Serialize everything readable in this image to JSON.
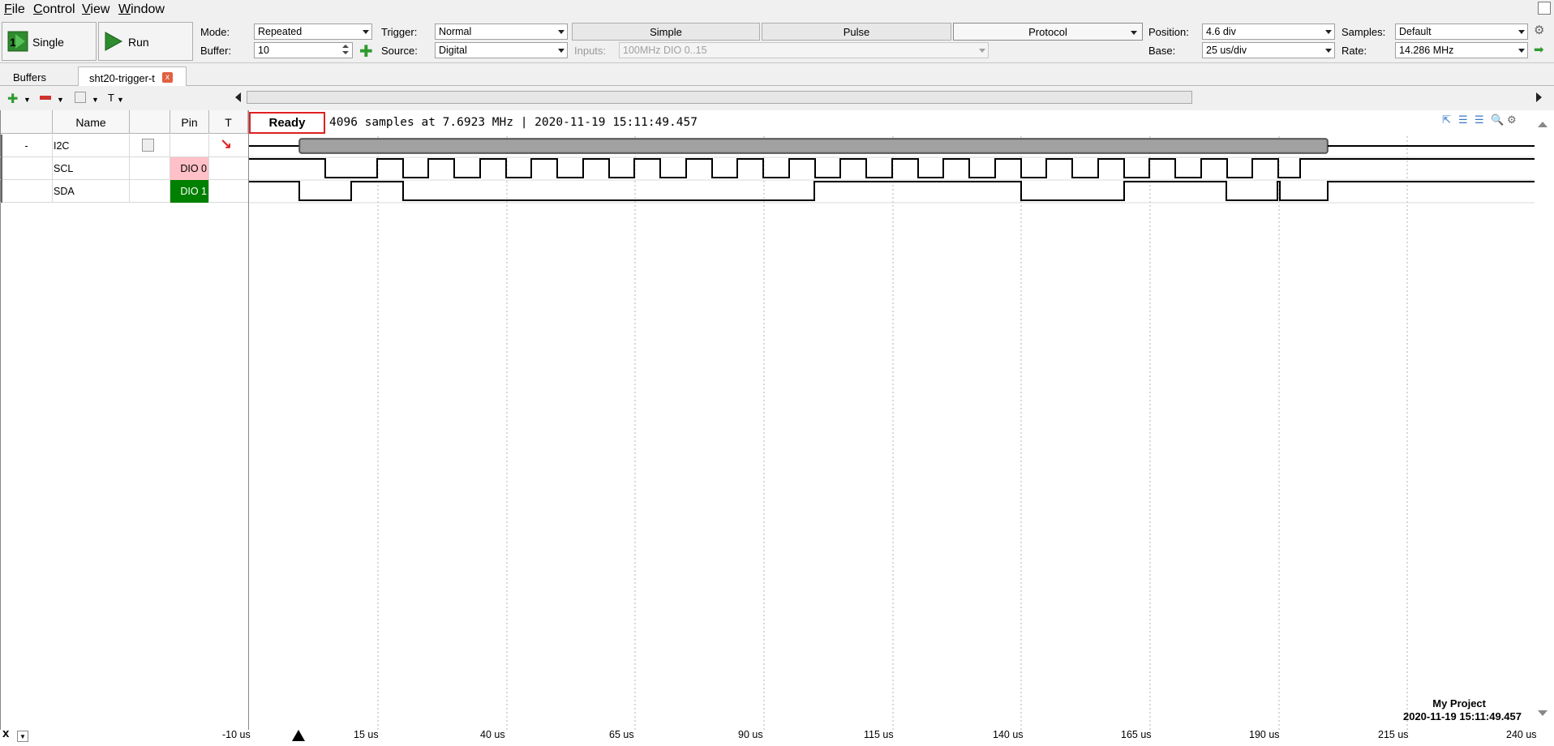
{
  "menu": {
    "items": [
      {
        "label": "File",
        "u": "F",
        "rest": "ile"
      },
      {
        "label": "Control",
        "u": "C",
        "rest": "ontrol"
      },
      {
        "label": "View",
        "u": "V",
        "rest": "iew"
      },
      {
        "label": "Window",
        "u": "W",
        "rest": "indow"
      }
    ]
  },
  "toolbar": {
    "single_label": "Single",
    "single_badge": "1",
    "run_label": "Run",
    "mode_label": "Mode:",
    "mode_value": "Repeated",
    "buffer_label": "Buffer:",
    "buffer_value": "10",
    "trigger_label": "Trigger:",
    "trigger_value": "Normal",
    "source_label": "Source:",
    "source_value": "Digital",
    "tabs": [
      "Simple",
      "Pulse",
      "Protocol"
    ],
    "inputs_label": "Inputs:",
    "inputs_value": "100MHz DIO 0..15",
    "position_label": "Position:",
    "position_value": "4.6 div",
    "base_label": "Base:",
    "base_value": "25 us/div",
    "samples_label": "Samples:",
    "samples_value": "Default",
    "rate_label": "Rate:",
    "rate_value": "14.286 MHz"
  },
  "doctabs": {
    "buffers": "Buffers",
    "file": "sht20-trigger-t",
    "close": "x"
  },
  "grid": {
    "headers": {
      "name": "Name",
      "pin": "Pin",
      "t": "T"
    },
    "rows": [
      {
        "expand": "-",
        "name": "I2C",
        "pin": ""
      },
      {
        "expand": "",
        "name": "SCL",
        "pin": "DIO 0"
      },
      {
        "expand": "",
        "name": "SDA",
        "pin": "DIO 1"
      }
    ]
  },
  "status": {
    "state": "Ready",
    "info": "4096 samples at 7.6923 MHz | 2020-11-19 15:11:49.457"
  },
  "axis": {
    "ticks": [
      "-10 us",
      "15 us",
      "40 us",
      "65 us",
      "90 us",
      "115 us",
      "140 us",
      "165 us",
      "190 us",
      "215 us",
      "240 us"
    ]
  },
  "project": {
    "name": "My Project",
    "timestamp": "2020-11-19 15:11:49.457"
  },
  "colors": {
    "ready_border": "#e02020",
    "pin_dio0": "#ffc0c8",
    "pin_dio1": "#008000",
    "run_green": "#2e8b2e"
  }
}
